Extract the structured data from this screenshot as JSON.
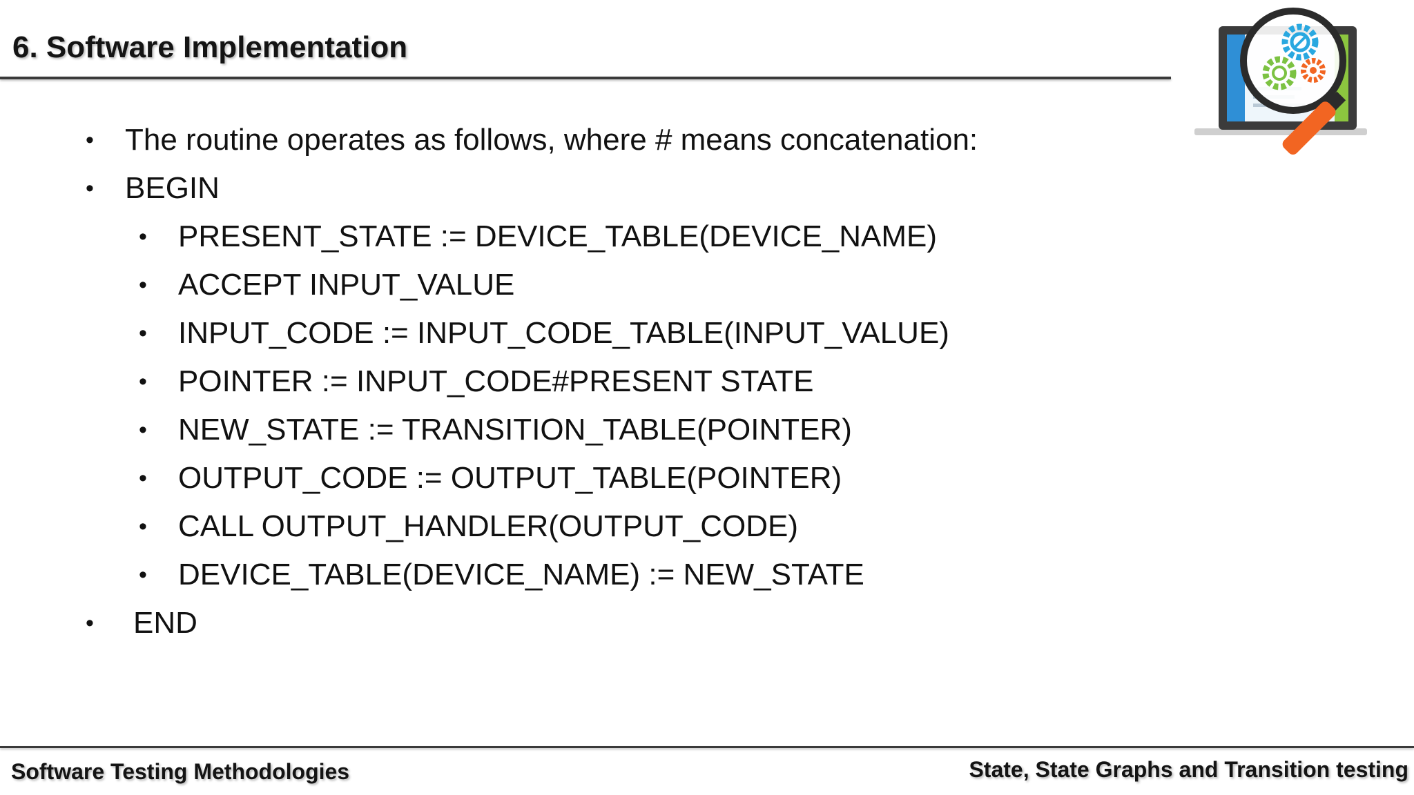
{
  "slide": {
    "title": "6. Software Implementation",
    "logo_icon": "laptop-magnifier-gears-icon",
    "colors": {
      "text": "#111111",
      "rule": "#3a3a3a",
      "laptop_frame": "#3b3b3b",
      "screen_blue": "#2f8fd6",
      "screen_green": "#8cc63f",
      "gear_blue": "#29a8e0",
      "gear_green": "#7cc242",
      "gear_orange": "#f26522",
      "magnifier_handle": "#f26522"
    }
  },
  "bullets": [
    {
      "text": "The routine operates as follows, where # means concatenation:",
      "level": 1
    },
    {
      "text": "BEGIN",
      "level": 1
    },
    {
      "text": "PRESENT_STATE := DEVICE_TABLE(DEVICE_NAME)",
      "level": 2
    },
    {
      "text": "ACCEPT INPUT_VALUE",
      "level": 2
    },
    {
      "text": "INPUT_CODE := INPUT_CODE_TABLE(INPUT_VALUE)",
      "level": 2
    },
    {
      "text": "POINTER := INPUT_CODE#PRESENT STATE",
      "level": 2
    },
    {
      "text": "NEW_STATE := TRANSITION_TABLE(POINTER)",
      "level": 2
    },
    {
      "text": "OUTPUT_CODE := OUTPUT_TABLE(POINTER)",
      "level": 2
    },
    {
      "text": "CALL OUTPUT_HANDLER(OUTPUT_CODE)",
      "level": 2
    },
    {
      "text": "DEVICE_TABLE(DEVICE_NAME) := NEW_STATE",
      "level": 2
    },
    {
      "text": "END",
      "level": 1
    }
  ],
  "bullet_glyph": "•",
  "footer": {
    "left": "Software Testing Methodologies",
    "right": "State, State Graphs and Transition testing"
  }
}
